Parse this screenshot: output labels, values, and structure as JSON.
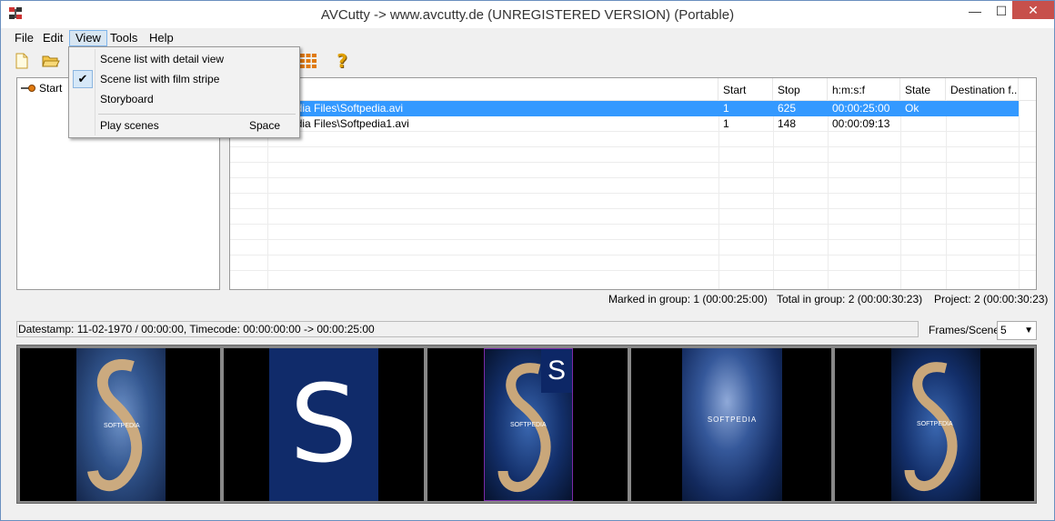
{
  "window": {
    "title": "AVCutty -> www.avcutty.de (UNREGISTERED VERSION) (Portable)",
    "minimize_glyph": "—",
    "maximize_glyph": "☐",
    "close_glyph": "✕"
  },
  "menubar": {
    "items": [
      "File",
      "Edit",
      "View",
      "Tools",
      "Help"
    ],
    "active": "View"
  },
  "view_menu": {
    "items": [
      {
        "label": "Scene list with detail view",
        "checked": false
      },
      {
        "label": "Scene list with film stripe",
        "checked": true
      },
      {
        "label": "Storyboard",
        "checked": false
      }
    ],
    "play_label": "Play scenes",
    "play_shortcut": "Space",
    "check_glyph": "✔"
  },
  "toolbar": {
    "icons": [
      "new-file-icon",
      "open-folder-icon",
      "storyboard-grid-icon",
      "help-icon"
    ],
    "help_glyph": "?"
  },
  "tree": {
    "root_label": "Start"
  },
  "scene_table": {
    "columns": [
      "e file",
      "Start",
      "Stop",
      "h:m:s:f",
      "State",
      "Destination f..."
    ],
    "rows": [
      {
        "file": "oftpedia Files\\Softpedia.avi",
        "start": "1",
        "stop": "625",
        "hmsf": "00:00:25:00",
        "state": "Ok",
        "dest": "",
        "selected": true
      },
      {
        "file": "oftpedia Files\\Softpedia1.avi",
        "start": "1",
        "stop": "148",
        "hmsf": "00:00:09:13",
        "state": "",
        "dest": "",
        "selected": false
      }
    ]
  },
  "status": {
    "marked": "Marked in group: 1 (00:00:25:00)",
    "total": "Total in group: 2 (00:00:30:23)",
    "project": "Project: 2 (00:00:30:23)"
  },
  "datestamp": "Datestamp: 11-02-1970 / 00:00:00, Timecode: 00:00:00:00 -> 00:00:25:00",
  "frames_per_scene": {
    "label": "Frames/Scene:",
    "value": "5"
  },
  "filmstrip": {
    "frames": 5,
    "thumb_captions": [
      "SOFTPEDIA",
      "S",
      "SOFTPEDIA",
      "SOFTPEDIA",
      "SOFTPEDIA"
    ],
    "selected_frame": 3
  },
  "colors": {
    "selection": "#3399ff",
    "menu_highlight": "#d8e6f2",
    "close_button": "#c7504b"
  }
}
